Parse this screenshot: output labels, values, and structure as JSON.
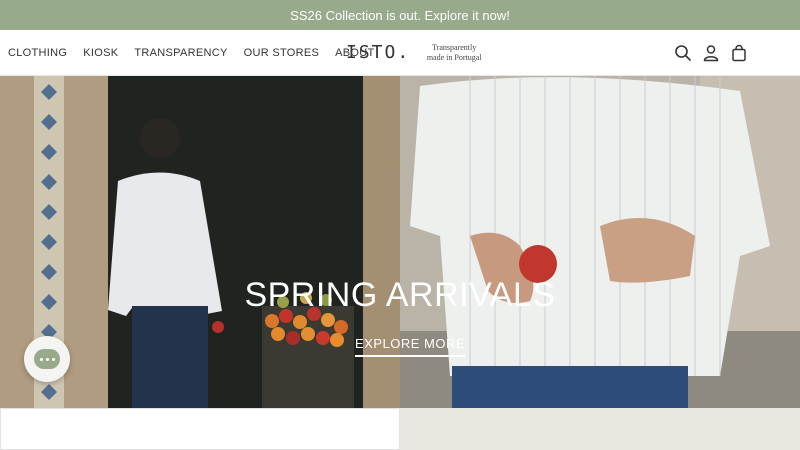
{
  "announcement": {
    "text": "SS26 Collection is out. Explore it now!",
    "bg_color": "#97aa8c"
  },
  "nav": {
    "items": [
      "CLOTHING",
      "KIOSK",
      "TRANSPARENCY",
      "OUR STORES",
      "ABOUT"
    ]
  },
  "brand": {
    "logo": "ISTO.",
    "tagline": "Transparently made in Portugal"
  },
  "header_icons": [
    "search-icon",
    "account-icon",
    "cart-icon"
  ],
  "hero": {
    "title": "SPRING ARRIVALS",
    "cta": "EXPLORE MORE"
  },
  "chat_widget": {
    "icon": "chat-icon",
    "color": "#97aa8c"
  }
}
